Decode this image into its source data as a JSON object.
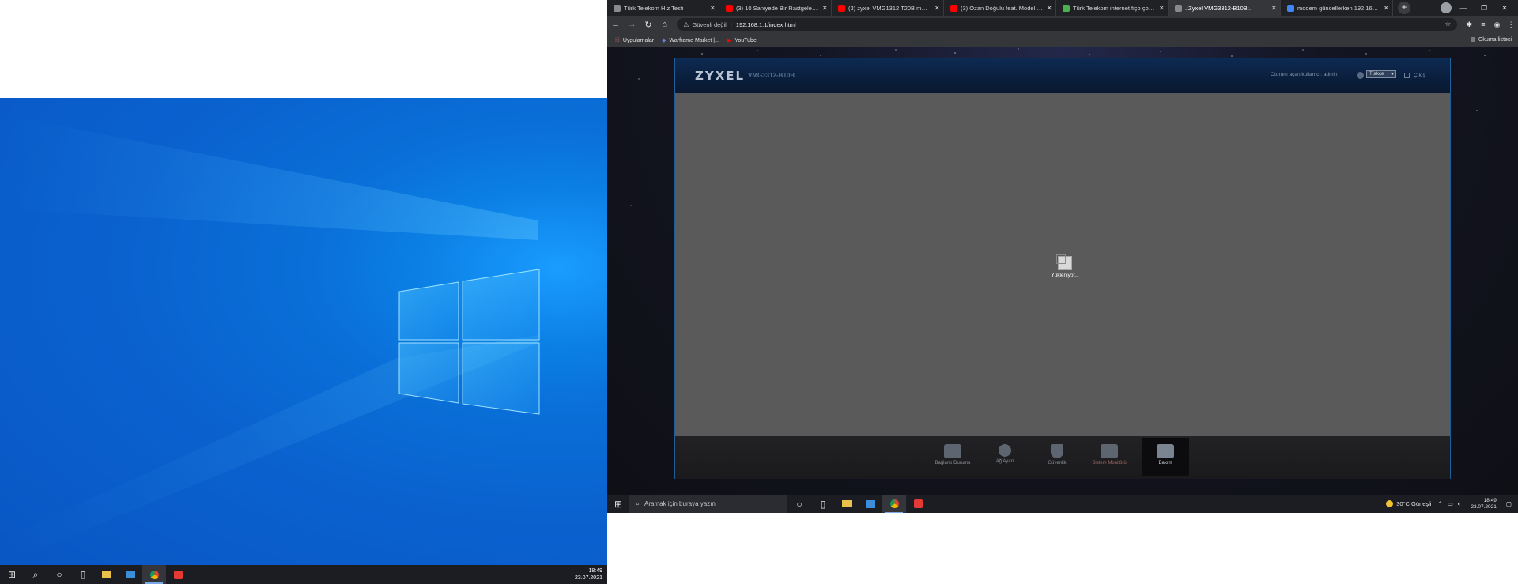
{
  "left_monitor": {
    "taskbar": {
      "apps": [
        "start",
        "search",
        "cortana",
        "task-view",
        "file-explorer",
        "app-blue",
        "chrome",
        "vivaldi"
      ],
      "clock_time": "18:49",
      "clock_date": "23.07.2021"
    }
  },
  "browser": {
    "tabs": [
      {
        "title": "Türk Telekom Hız Testi",
        "favicon_color": "#8a8a8a"
      },
      {
        "title": "(3) 10 Saniyede Bir Rastgele Feli...",
        "favicon_color": "#ff0000"
      },
      {
        "title": "(3) zyxel VMG1312 T20B modem...",
        "favicon_color": "#ff0000"
      },
      {
        "title": "(3) Ozan Doğulu feat. Model - D...",
        "favicon_color": "#ff0000"
      },
      {
        "title": "Türk Telekom internet fiço çok y...",
        "favicon_color": "#4caf50"
      },
      {
        "title": ".:Zyxel VMG3312-B10B:.",
        "favicon_color": "#8a8a8a",
        "active": true
      },
      {
        "title": "modem güncellerken 192.168.1...",
        "favicon_color": "#4285f4"
      }
    ],
    "new_tab_label": "+",
    "omnibox": {
      "security_label": "Güvenli değil",
      "url": "192.168.1.1/index.html"
    },
    "bookmarks": [
      {
        "label": "Uygulamalar"
      },
      {
        "label": "Warframe Market |..."
      },
      {
        "label": "YouTube"
      }
    ],
    "reading_list_label": "Okuma listesi"
  },
  "router": {
    "brand": "ZYXEL",
    "model": "VMG3312-B10B",
    "session_label": "Oturum açan kullanıcı: admin",
    "language": "Türkçe",
    "logout_label": "Çıkış",
    "loading_label": "Yükleniyor...",
    "nav": [
      {
        "label": "Bağlantı Durumu",
        "icon": "connection-status-icon"
      },
      {
        "label": "Ağ Ayarı",
        "icon": "network-settings-icon"
      },
      {
        "label": "Güvenlik",
        "icon": "security-shield-icon"
      },
      {
        "label": "Sistem Monitörü",
        "icon": "system-monitor-icon"
      },
      {
        "label": "Bakım",
        "icon": "maintenance-icon",
        "active": true
      }
    ]
  },
  "right_taskbar": {
    "search_placeholder": "Aramak için buraya yazın",
    "weather": "30°C  Güneşli",
    "clock_time": "18:49",
    "clock_date": "23.07.2021"
  }
}
